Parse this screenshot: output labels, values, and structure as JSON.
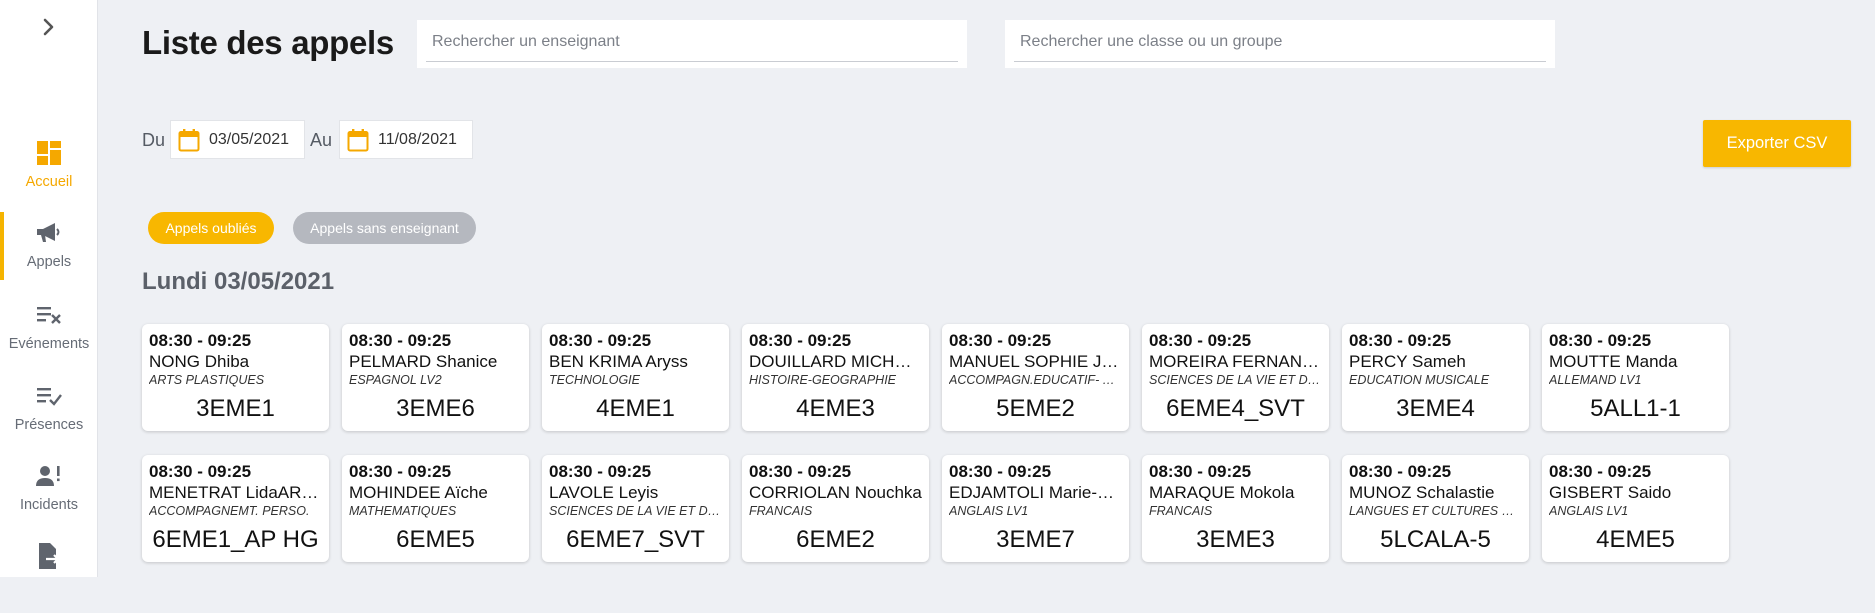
{
  "sidebar": {
    "items": [
      {
        "label": "Accueil",
        "icon": "dashboard-icon"
      },
      {
        "label": "Appels",
        "icon": "megaphone-icon"
      },
      {
        "label": "Evénements",
        "icon": "list-remove-icon"
      },
      {
        "label": "Présences",
        "icon": "list-check-icon"
      },
      {
        "label": "Incidents",
        "icon": "person-alert-icon"
      },
      {
        "label": "",
        "icon": "file-export-icon"
      }
    ]
  },
  "header": {
    "title": "Liste des appels",
    "search_teacher_placeholder": "Rechercher un enseignant",
    "search_class_placeholder": "Rechercher une classe ou un groupe"
  },
  "filters": {
    "from_label": "Du",
    "from_date": "03/05/2021",
    "to_label": "Au",
    "to_date": "11/08/2021",
    "export_label": "Exporter CSV",
    "pill_forgotten": "Appels oubliés",
    "pill_no_teacher": "Appels sans enseignant"
  },
  "colors": {
    "accent": "#f8b700",
    "pill_grey": "#b5b8bf",
    "background": "#eef0f4"
  },
  "day": {
    "heading": "Lundi 03/05/2021",
    "cards": [
      {
        "time": "08:30 - 09:25",
        "teacher": "NONG Dhiba",
        "subject": "ARTS PLASTIQUES",
        "group": "3EME1"
      },
      {
        "time": "08:30 - 09:25",
        "teacher": "PELMARD Shanice",
        "subject": "ESPAGNOL LV2",
        "group": "3EME6"
      },
      {
        "time": "08:30 - 09:25",
        "teacher": "BEN KRIMA Aryss",
        "subject": "TECHNOLOGIE",
        "group": "4EME1"
      },
      {
        "time": "08:30 - 09:25",
        "teacher": "DOUILLARD MICHEL…",
        "subject": "HISTOIRE-GEOGRAPHIE",
        "group": "4EME3"
      },
      {
        "time": "08:30 - 09:25",
        "teacher": "MANUEL SOPHIE JE…",
        "subject": "ACCOMPAGN.EDUCATIF- A…",
        "group": "5EME2"
      },
      {
        "time": "08:30 - 09:25",
        "teacher": "MOREIRA FERNAND…",
        "subject": "SCIENCES DE LA VIE ET DE…",
        "group": "6EME4_SVT"
      },
      {
        "time": "08:30 - 09:25",
        "teacher": "PERCY Sameh",
        "subject": "EDUCATION MUSICALE",
        "group": "3EME4"
      },
      {
        "time": "08:30 - 09:25",
        "teacher": "MOUTTE Manda",
        "subject": "ALLEMAND LV1",
        "group": "5ALL1-1"
      },
      {
        "time": "08:30 - 09:25",
        "teacher": "MENETRAT LidaARA…",
        "subject": "ACCOMPAGNEMT. PERSO.",
        "group": "6EME1_AP HG"
      },
      {
        "time": "08:30 - 09:25",
        "teacher": "MOHINDEE Aïche",
        "subject": "MATHEMATIQUES",
        "group": "6EME5"
      },
      {
        "time": "08:30 - 09:25",
        "teacher": "LAVOLE Leyis",
        "subject": "SCIENCES DE LA VIE ET DE…",
        "group": "6EME7_SVT"
      },
      {
        "time": "08:30 - 09:25",
        "teacher": "CORRIOLAN Nouchka",
        "subject": "FRANCAIS",
        "group": "6EME2"
      },
      {
        "time": "08:30 - 09:25",
        "teacher": "EDJAMTOLI Marie-G…",
        "subject": "ANGLAIS LV1",
        "group": "3EME7"
      },
      {
        "time": "08:30 - 09:25",
        "teacher": "MARAQUE Mokola",
        "subject": "FRANCAIS",
        "group": "3EME3"
      },
      {
        "time": "08:30 - 09:25",
        "teacher": "MUNOZ Schalastie",
        "subject": "LANGUES ET CULTURES DE…",
        "group": "5LCALA-5"
      },
      {
        "time": "08:30 - 09:25",
        "teacher": "GISBERT Saido",
        "subject": "ANGLAIS LV1",
        "group": "4EME5"
      }
    ]
  }
}
